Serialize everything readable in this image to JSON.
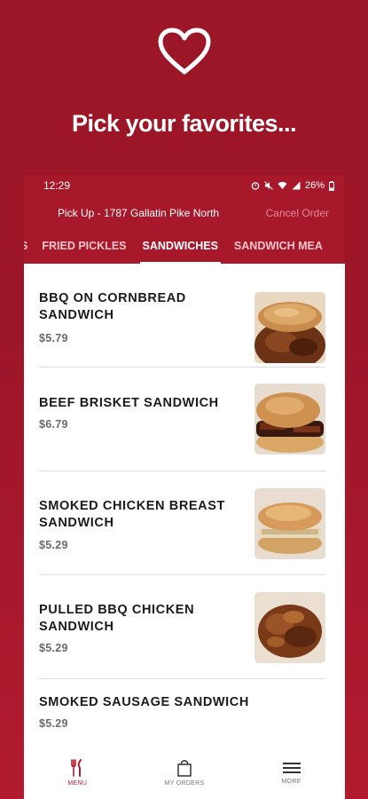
{
  "promo": {
    "heart_icon": "heart-outline-icon",
    "headline": "Pick your favorites..."
  },
  "status_bar": {
    "time": "12:29",
    "battery": "26%"
  },
  "header": {
    "pickup": "Pick Up - 1787 Gallatin Pike North",
    "cancel": "Cancel Order"
  },
  "tabs": [
    {
      "label": "S"
    },
    {
      "label": "FRIED PICKLES"
    },
    {
      "label": "SANDWICHES",
      "active": true
    },
    {
      "label": "SANDWICH MEA"
    }
  ],
  "menu": {
    "items": [
      {
        "name": "BBQ ON CORNBREAD SANDWICH",
        "price": "$5.79",
        "image": "cornbread-sandwich"
      },
      {
        "name": "BEEF BRISKET SANDWICH",
        "price": "$6.79",
        "image": "brisket-sandwich"
      },
      {
        "name": "SMOKED CHICKEN BREAST SANDWICH",
        "price": "$5.29",
        "image": "chicken-sandwich"
      },
      {
        "name": "PULLED BBQ CHICKEN SANDWICH",
        "price": "$5.29",
        "image": "pulled-chicken"
      },
      {
        "name": "SMOKED SAUSAGE SANDWICH",
        "price": "$5.29"
      }
    ]
  },
  "bottom_nav": {
    "menu": "MENU",
    "orders": "MY ORDERS",
    "more": "MORE"
  },
  "colors": {
    "brand": "#a8182b",
    "background": "#9c1628"
  }
}
